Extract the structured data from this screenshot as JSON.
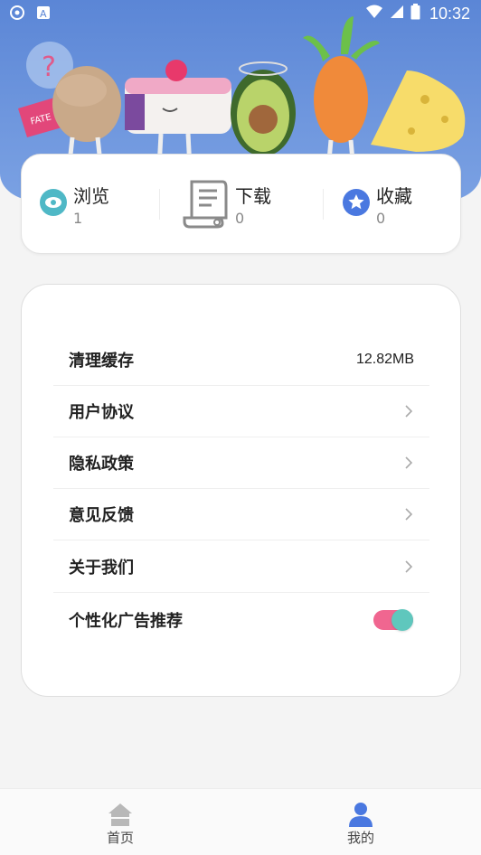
{
  "status_bar": {
    "time": "10:32"
  },
  "stats": [
    {
      "label": "浏览",
      "count": "1",
      "icon": "eye-icon",
      "color": "#4fb8c6"
    },
    {
      "label": "下载",
      "count": "0",
      "icon": "scroll-icon",
      "color": "#8a8a8a"
    },
    {
      "label": "收藏",
      "count": "0",
      "icon": "star-badge-icon",
      "color": "#4a78e0"
    }
  ],
  "settings": {
    "clear_cache": {
      "label": "清理缓存",
      "value": "12.82MB"
    },
    "user_agreement": {
      "label": "用户协议"
    },
    "privacy_policy": {
      "label": "隐私政策"
    },
    "feedback": {
      "label": "意见反馈"
    },
    "about_us": {
      "label": "关于我们"
    },
    "personalized_ads": {
      "label": "个性化广告推荐",
      "enabled": true
    }
  },
  "bottom_nav": {
    "home": {
      "label": "首页",
      "icon": "home-icon"
    },
    "mine": {
      "label": "我的",
      "icon": "person-icon",
      "active": true
    }
  },
  "colors": {
    "banner": "#5b86d6",
    "toggle_track": "#f06690",
    "toggle_knob": "#5fc7bd",
    "nav_active": "#4a78e0"
  }
}
